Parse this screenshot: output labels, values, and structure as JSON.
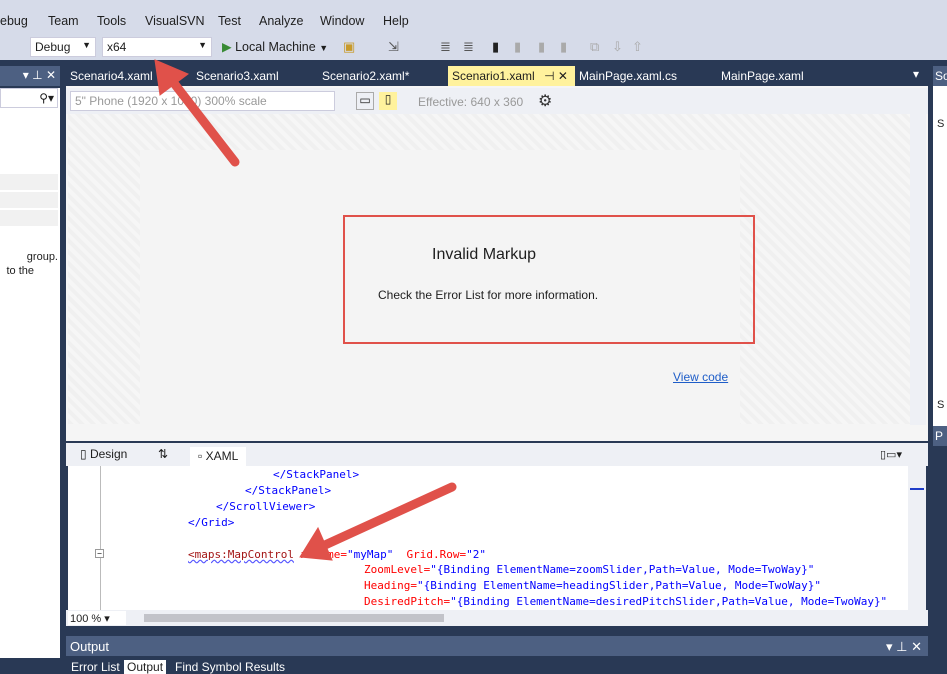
{
  "menu": [
    "ebug",
    "Team",
    "Tools",
    "VisualSVN",
    "Test",
    "Analyze",
    "Window",
    "Help"
  ],
  "toolbar": {
    "config": "Debug",
    "platform": "x64",
    "run_label": "Local Machine"
  },
  "tabs": [
    {
      "label": "Scenario4.xaml"
    },
    {
      "label": "Scenario3.xaml"
    },
    {
      "label": "Scenario2.xaml*"
    },
    {
      "label": "Scenario1.xaml",
      "active": true
    },
    {
      "label": "MainPage.xaml.cs"
    },
    {
      "label": "MainPage.xaml"
    }
  ],
  "left_panel": {
    "text1": "group.",
    "text2": "to the"
  },
  "right_panel": {
    "header1": "So",
    "item1": "S",
    "item2": "S",
    "header2": "P"
  },
  "designer": {
    "device": "5\" Phone (1920 x 1080) 300% scale",
    "effective": "Effective: 640 x 360",
    "error_title": "Invalid Markup",
    "error_msg": "Check the Error List for more information.",
    "view_code": "View code"
  },
  "split": {
    "design": "Design",
    "swap": "⇅",
    "xaml": "XAML"
  },
  "code": {
    "l1": "</StackPanel>",
    "l2": "</StackPanel>",
    "l3": "</ScrollViewer>",
    "l4": "</Grid>",
    "l5_tag": "<maps:MapControl",
    "l5_attr": " x:Name=",
    "l5_val": "\"myMap\"",
    "l5_attr2": "  Grid.Row=",
    "l5_val2": "\"2\"",
    "l6_attr": "ZoomLevel=",
    "l6_val": "\"{Binding ElementName=zoomSlider,Path=Value, Mode=TwoWay}\"",
    "l7_attr": "Heading=",
    "l7_val": "\"{Binding ElementName=headingSlider,Path=Value, Mode=TwoWay}\"",
    "l8_attr": "DesiredPitch=",
    "l8_val": "\"{Binding ElementName=desiredPitchSlider,Path=Value, Mode=TwoWay}\""
  },
  "zoom": "100 %",
  "output": {
    "title": "Output",
    "tabs": [
      "Error List",
      "Output",
      "Find Symbol Results"
    ]
  },
  "colors": {
    "frame": "#293955",
    "active_tab": "#fff29d",
    "annotation": "#e0514a"
  }
}
